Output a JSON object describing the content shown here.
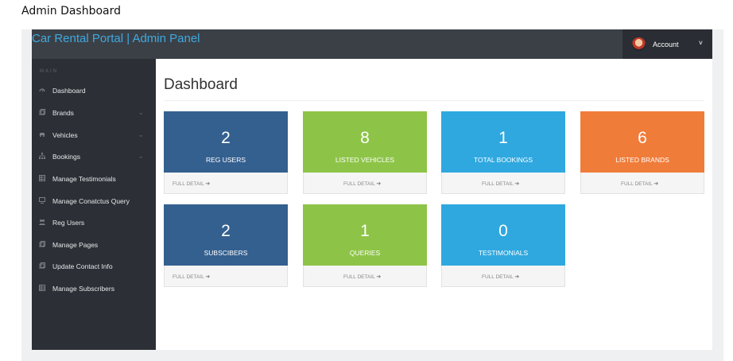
{
  "caption": "Admin Dashboard",
  "header": {
    "brand": "Car Rental Portal | Admin Panel",
    "account_label": "Account",
    "account_chevron": "˅"
  },
  "sidebar": {
    "heading": "MAIN",
    "items": [
      {
        "label": "Dashboard",
        "icon": "dashboard-icon",
        "has_submenu": false
      },
      {
        "label": "Brands",
        "icon": "files-icon",
        "has_submenu": true
      },
      {
        "label": "Vehicles",
        "icon": "car-icon",
        "has_submenu": true
      },
      {
        "label": "Bookings",
        "icon": "sitemap-icon",
        "has_submenu": true
      },
      {
        "label": "Manage Testimonials",
        "icon": "table-icon",
        "has_submenu": false
      },
      {
        "label": "Manage Conatctus Query",
        "icon": "desktop-icon",
        "has_submenu": false
      },
      {
        "label": "Reg Users",
        "icon": "users-icon",
        "has_submenu": false
      },
      {
        "label": "Manage Pages",
        "icon": "files-icon",
        "has_submenu": false
      },
      {
        "label": "Update Contact Info",
        "icon": "files-icon",
        "has_submenu": false
      },
      {
        "label": "Manage Subscribers",
        "icon": "table-icon",
        "has_submenu": false
      }
    ],
    "chevron": "⌄"
  },
  "main": {
    "title": "Dashboard",
    "cards": [
      {
        "value": "2",
        "label": "REG USERS",
        "link": "FULL DETAIL",
        "color": "#34608f"
      },
      {
        "value": "8",
        "label": "LISTED VEHICLES",
        "link": "FULL DETAIL",
        "color": "#8dc447"
      },
      {
        "value": "1",
        "label": "TOTAL BOOKINGS",
        "link": "FULL DETAIL",
        "color": "#2fa8df"
      },
      {
        "value": "6",
        "label": "LISTED BRANDS",
        "link": "FULL DETAIL",
        "color": "#f07c3a"
      },
      {
        "value": "2",
        "label": "SUBSCIBERS",
        "link": "FULL DETAIL",
        "color": "#34608f"
      },
      {
        "value": "1",
        "label": "QUERIES",
        "link": "FULL DETAIL",
        "color": "#8dc447"
      },
      {
        "value": "0",
        "label": "TESTIMONIALS",
        "link": "FULL DETAIL",
        "color": "#2fa8df"
      }
    ],
    "link_arrow": "➔"
  }
}
